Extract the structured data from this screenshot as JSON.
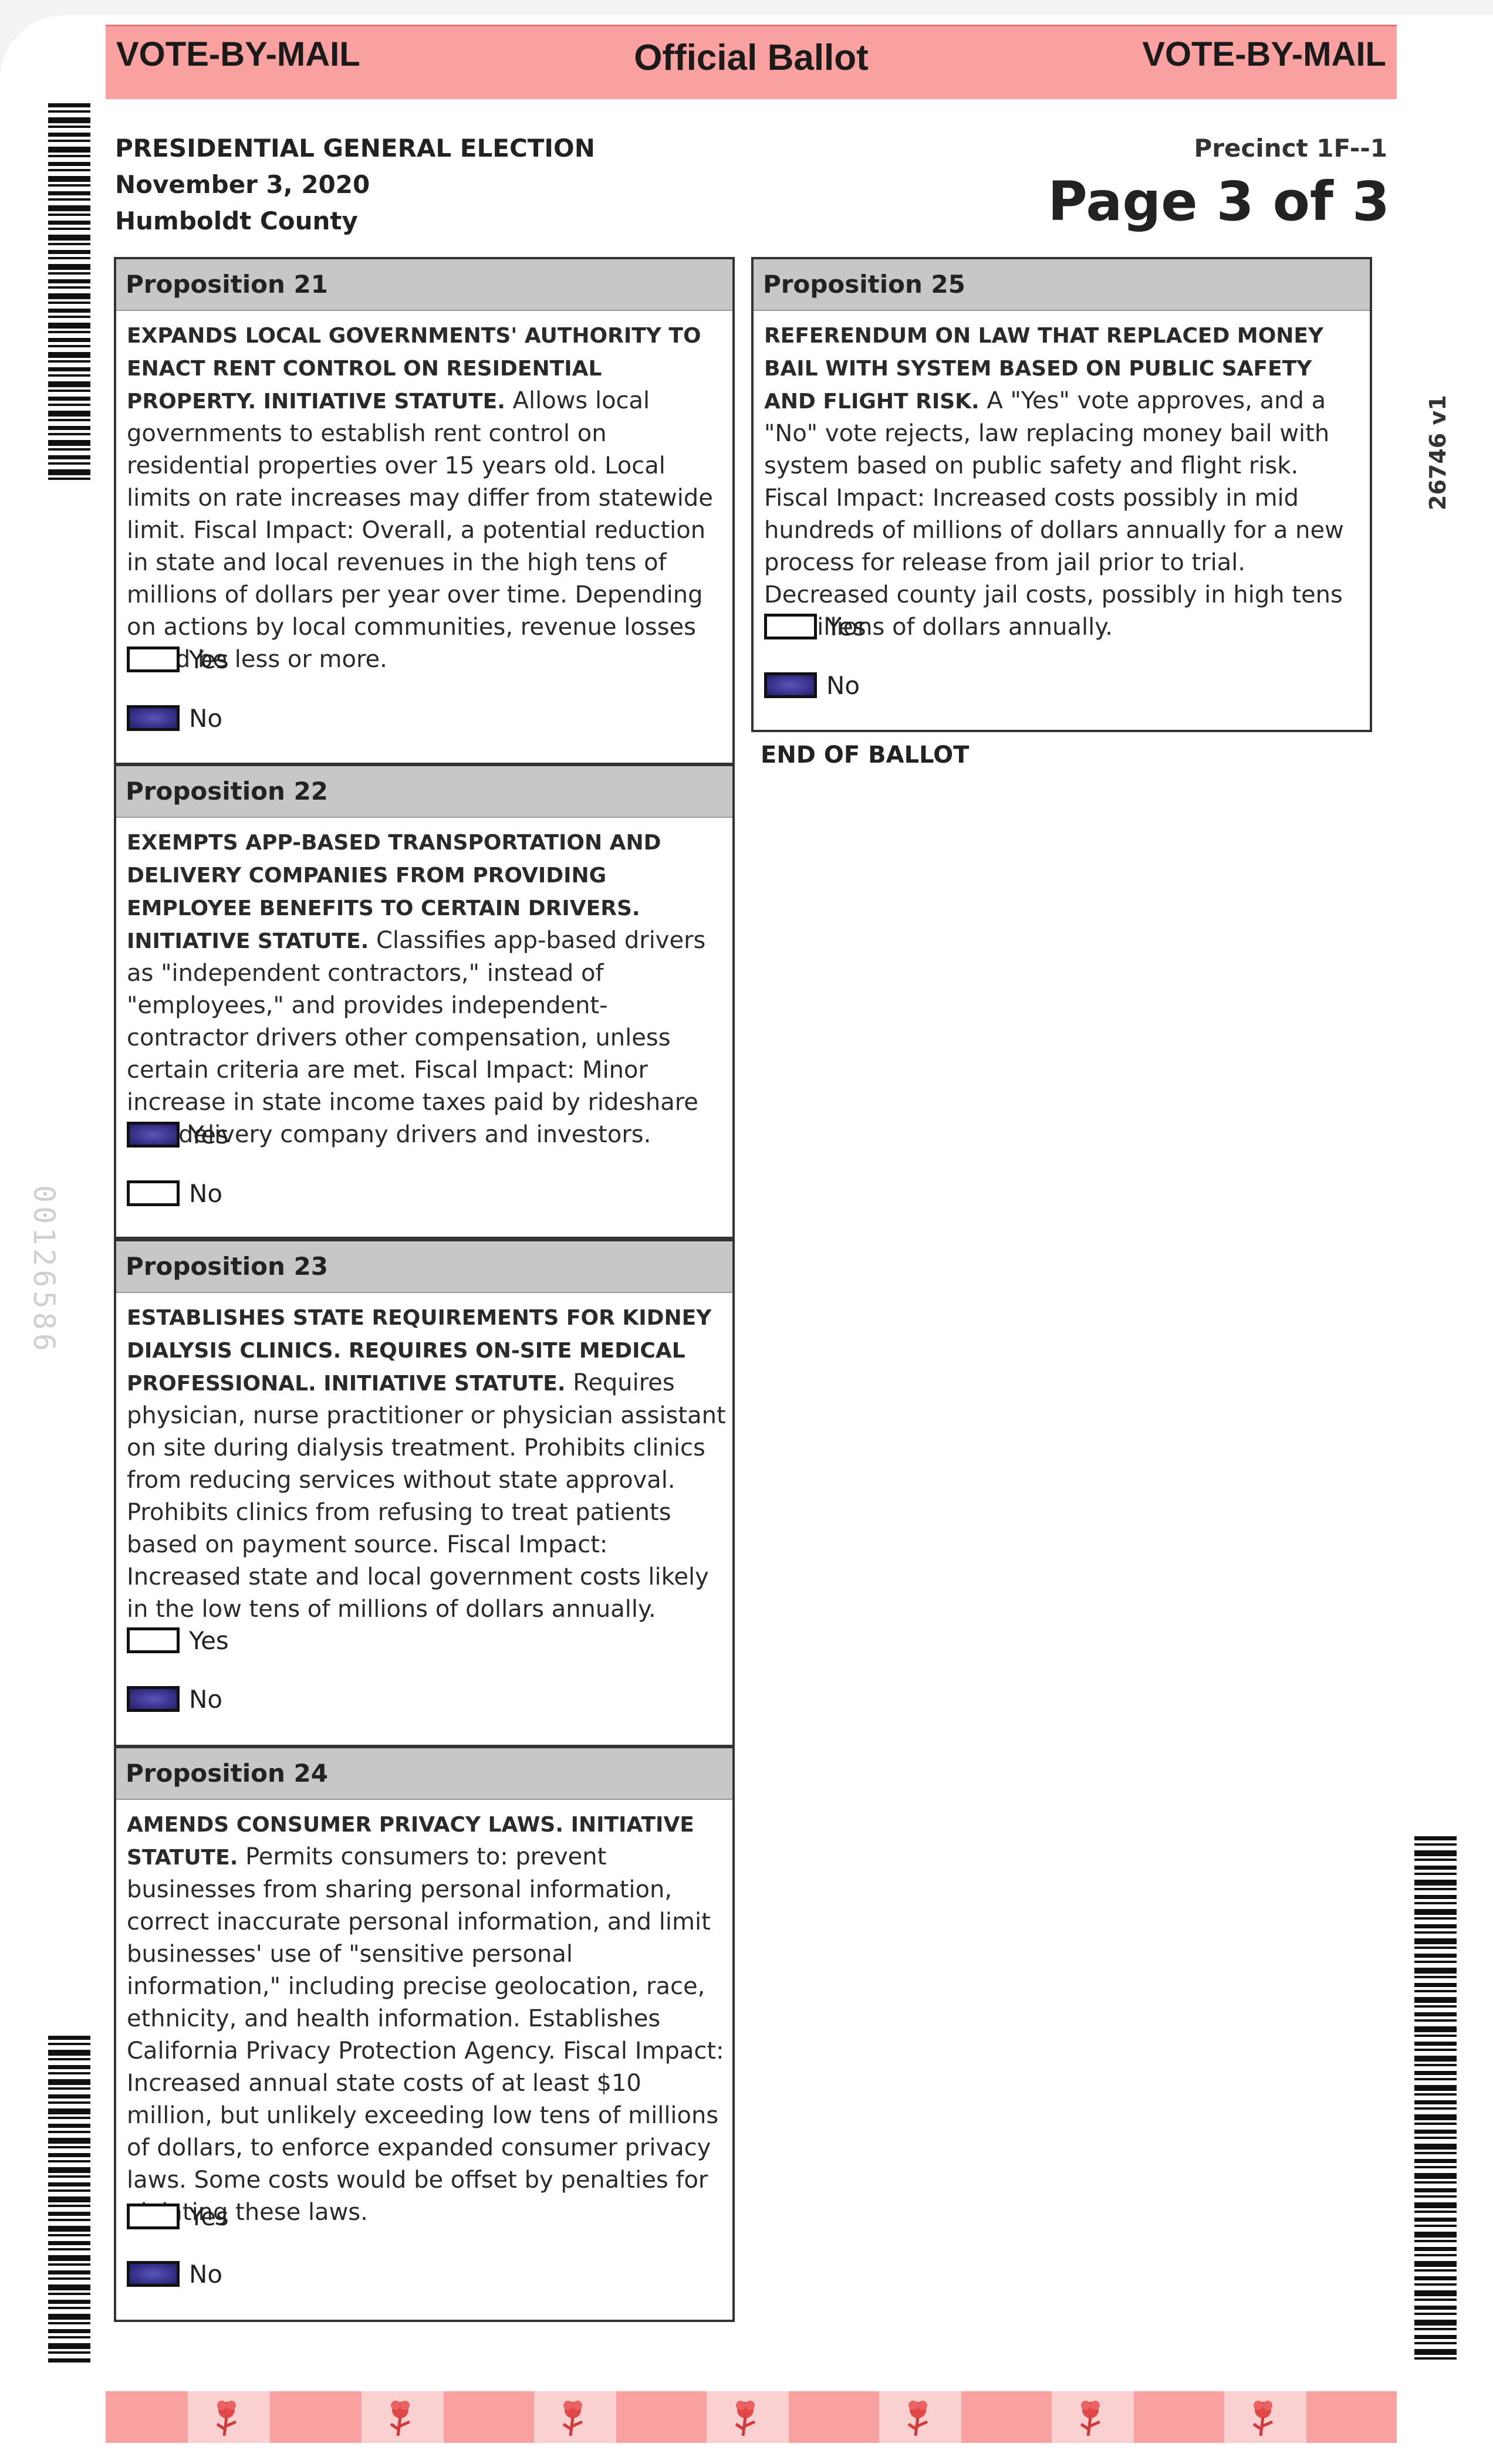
{
  "bands": {
    "left": "VOTE-BY-MAIL",
    "center": "Official Ballot",
    "right": "VOTE-BY-MAIL"
  },
  "header": {
    "election": "PRESIDENTIAL GENERAL ELECTION",
    "date": "November 3, 2020",
    "county": "Humboldt County",
    "precinct": "Precinct 1F--1",
    "page": "Page 3 of 3"
  },
  "side_code": "26746 v1",
  "serial": "00126586",
  "propositions": [
    {
      "title": "Proposition 21",
      "summary_bold": "EXPANDS LOCAL GOVERNMENTS' AUTHORITY TO ENACT RENT CONTROL ON RESIDENTIAL PROPERTY. INITIATIVE STATUTE.",
      "summary_text": "Allows local governments to establish rent control on residential properties over 15 years old. Local limits on rate increases may differ from statewide limit. Fiscal Impact: Overall, a potential reduction in state and local revenues in the high tens of millions of dollars per year over time. Depending on actions by local communities, revenue losses could be less or more.",
      "yes": "Yes",
      "no": "No",
      "marked": "no"
    },
    {
      "title": "Proposition 22",
      "summary_bold": "EXEMPTS APP-BASED TRANSPORTATION AND DELIVERY COMPANIES FROM PROVIDING EMPLOYEE BENEFITS TO CERTAIN DRIVERS. INITIATIVE STATUTE.",
      "summary_text": "Classifies app-based drivers as \"independent contractors,\" instead of \"employees,\" and provides independent-contractor drivers other compensation, unless certain criteria are met. Fiscal Impact: Minor increase in state income taxes paid by rideshare and delivery company drivers and investors.",
      "yes": "Yes",
      "no": "No",
      "marked": "yes"
    },
    {
      "title": "Proposition 23",
      "summary_bold": "ESTABLISHES STATE REQUIREMENTS FOR KIDNEY DIALYSIS CLINICS. REQUIRES ON-SITE MEDICAL PROFESSIONAL. INITIATIVE STATUTE.",
      "summary_text": "Requires physician, nurse practitioner or physician assistant on site during dialysis treatment. Prohibits clinics from reducing services without state approval. Prohibits clinics from refusing to treat patients based on payment source. Fiscal Impact: Increased state and local government costs likely in the low tens of millions of dollars annually.",
      "yes": "Yes",
      "no": "No",
      "marked": "no"
    },
    {
      "title": "Proposition 24",
      "summary_bold": "AMENDS CONSUMER PRIVACY LAWS. INITIATIVE STATUTE.",
      "summary_text": "Permits consumers to: prevent businesses from sharing personal information, correct inaccurate personal information, and limit businesses' use of \"sensitive personal information,\" including precise geolocation, race, ethnicity, and health information. Establishes California Privacy Protection Agency. Fiscal Impact: Increased annual state costs of at least $10 million, but unlikely exceeding low tens of millions of dollars, to enforce expanded consumer privacy laws. Some costs would be offset by penalties for violating these laws.",
      "yes": "Yes",
      "no": "No",
      "marked": "no"
    },
    {
      "title": "Proposition 25",
      "summary_bold": "REFERENDUM ON LAW THAT REPLACED MONEY BAIL WITH SYSTEM BASED ON PUBLIC SAFETY AND FLIGHT RISK.",
      "summary_text": "A \"Yes\" vote approves, and a \"No\" vote rejects, law replacing money bail with system based on public safety and flight risk. Fiscal Impact: Increased costs possibly in mid hundreds of millions of dollars annually for a new process for release from jail prior to trial. Decreased county jail costs, possibly in high tens of millions of dollars annually.",
      "yes": "Yes",
      "no": "No",
      "marked": "no"
    }
  ],
  "end_label": "END OF BALLOT",
  "colors": {
    "band": "#f9a0a0",
    "mark": "#3b3690",
    "section_header": "#c7c7c7"
  }
}
